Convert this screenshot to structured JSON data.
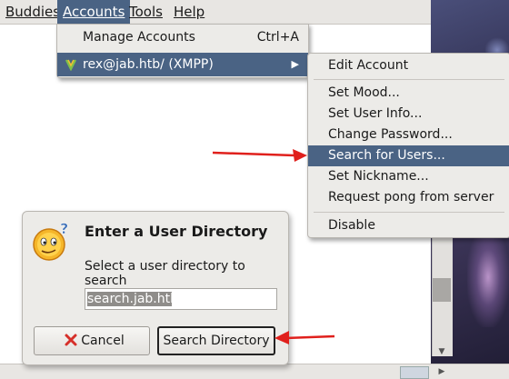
{
  "menubar": {
    "items": [
      {
        "label": "Buddies",
        "mnemonic_index": 0
      },
      {
        "label": "Accounts",
        "mnemonic_index": 0
      },
      {
        "label": "Tools",
        "mnemonic_index": 0
      },
      {
        "label": "Help",
        "mnemonic_index": 0
      }
    ]
  },
  "accounts_menu": {
    "manage": {
      "label": "Manage Accounts",
      "shortcut": "Ctrl+A"
    },
    "account": {
      "label": "rex@jab.htb/ (XMPP)"
    }
  },
  "account_submenu": {
    "items": [
      "Edit Account",
      "Set Mood...",
      "Set User Info...",
      "Change Password...",
      "Search for Users...",
      "Set Nickname...",
      "Request pong from server",
      "Disable"
    ],
    "highlighted": "Search for Users..."
  },
  "dialog": {
    "title": "Enter a User Directory",
    "description": "Select a user directory to search",
    "directory_value": "search.jab.htb",
    "cancel_label": "Cancel",
    "search_label": "Search Directory"
  },
  "colors": {
    "highlight": "#4a6384",
    "menu_bg": "#ecebe8",
    "annotation_arrow": "#e0201c"
  }
}
